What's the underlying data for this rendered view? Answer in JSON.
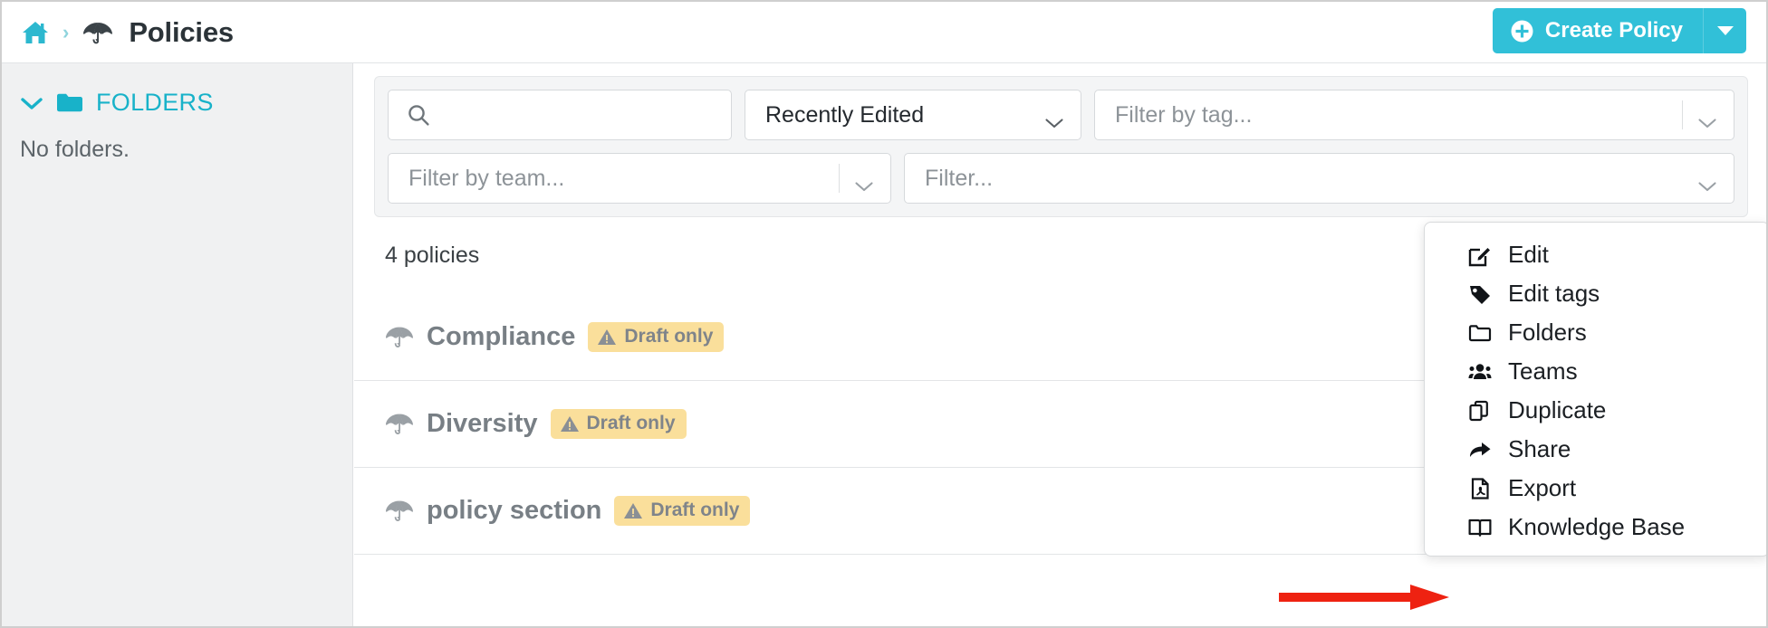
{
  "header": {
    "home_icon": "home-icon",
    "separator": "›",
    "policy_icon": "umbrella-icon",
    "title": "Policies",
    "create_button": {
      "label": "Create Policy",
      "icon": "plus-circle-icon",
      "caret_icon": "caret-down-icon",
      "color": "#31c0d8"
    }
  },
  "sidebar": {
    "collapse_icon": "chevron-down-icon",
    "folder_icon": "folder-icon",
    "section_title": "FOLDERS",
    "empty_text": "No folders.",
    "accent_color": "#18b2c9"
  },
  "filters": {
    "search": {
      "placeholder": "",
      "value": "",
      "icon": "search-icon"
    },
    "sort": {
      "value": "Recently Edited",
      "icon": "chevron-down-icon"
    },
    "tag": {
      "placeholder": "Filter by tag...",
      "icon": "chevron-down-icon"
    },
    "team": {
      "placeholder": "Filter by team...",
      "icon": "chevron-down-icon"
    },
    "generic": {
      "placeholder": "Filter...",
      "icon": "chevron-down-icon"
    }
  },
  "list": {
    "count_text": "4 policies",
    "badge_color": "#fadf9b",
    "rows": [
      {
        "icon": "umbrella-icon",
        "name": "Compliance",
        "badge": "Draft only",
        "badge_icon": "warning-triangle-icon"
      },
      {
        "icon": "umbrella-icon",
        "name": "Diversity",
        "badge": "Draft only",
        "badge_icon": "warning-triangle-icon"
      },
      {
        "icon": "umbrella-icon",
        "name": "policy section",
        "badge": "Draft only",
        "badge_icon": "warning-triangle-icon"
      }
    ]
  },
  "context_menu": {
    "items": [
      {
        "label": "Edit",
        "icon": "edit-pencil-icon"
      },
      {
        "label": "Edit tags",
        "icon": "tag-icon"
      },
      {
        "label": "Folders",
        "icon": "folder-outline-icon"
      },
      {
        "label": "Teams",
        "icon": "users-icon"
      },
      {
        "label": "Duplicate",
        "icon": "copy-icon"
      },
      {
        "label": "Share",
        "icon": "share-arrow-icon"
      },
      {
        "label": "Export",
        "icon": "file-pdf-icon"
      },
      {
        "label": "Knowledge Base",
        "icon": "open-book-icon"
      }
    ]
  },
  "annotation": {
    "arrow_color": "#ee2211",
    "points_to": "Knowledge Base"
  }
}
